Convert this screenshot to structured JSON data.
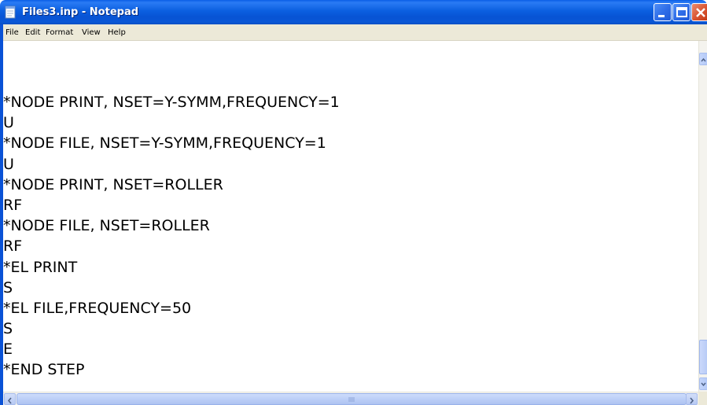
{
  "window": {
    "title": "Files3.inp - Notepad"
  },
  "menu": [
    "File",
    "Edit",
    "Format",
    "View",
    "Help"
  ],
  "editor": {
    "lines": [
      "*NODE PRINT, NSET=Y-SYMM,FREQUENCY=1",
      "U",
      "*NODE FILE, NSET=Y-SYMM,FREQUENCY=1",
      "U",
      "*NODE PRINT, NSET=ROLLER",
      "RF",
      "*NODE FILE, NSET=ROLLER",
      "RF",
      "*EL PRINT",
      "S",
      "*EL FILE,FREQUENCY=50",
      "S",
      "E",
      "*END STEP"
    ]
  },
  "icons": {
    "app": "notepad-icon",
    "minimize": "minimize-icon",
    "maximize": "maximize-icon",
    "close": "close-icon",
    "scroll_up": "arrow-up-icon",
    "scroll_down": "arrow-down-icon",
    "scroll_left": "arrow-left-icon",
    "scroll_right": "arrow-right-icon"
  },
  "colors": {
    "titlebar": "#0a5ee6",
    "menubar": "#ece9d8",
    "close_button": "#d8522f"
  }
}
